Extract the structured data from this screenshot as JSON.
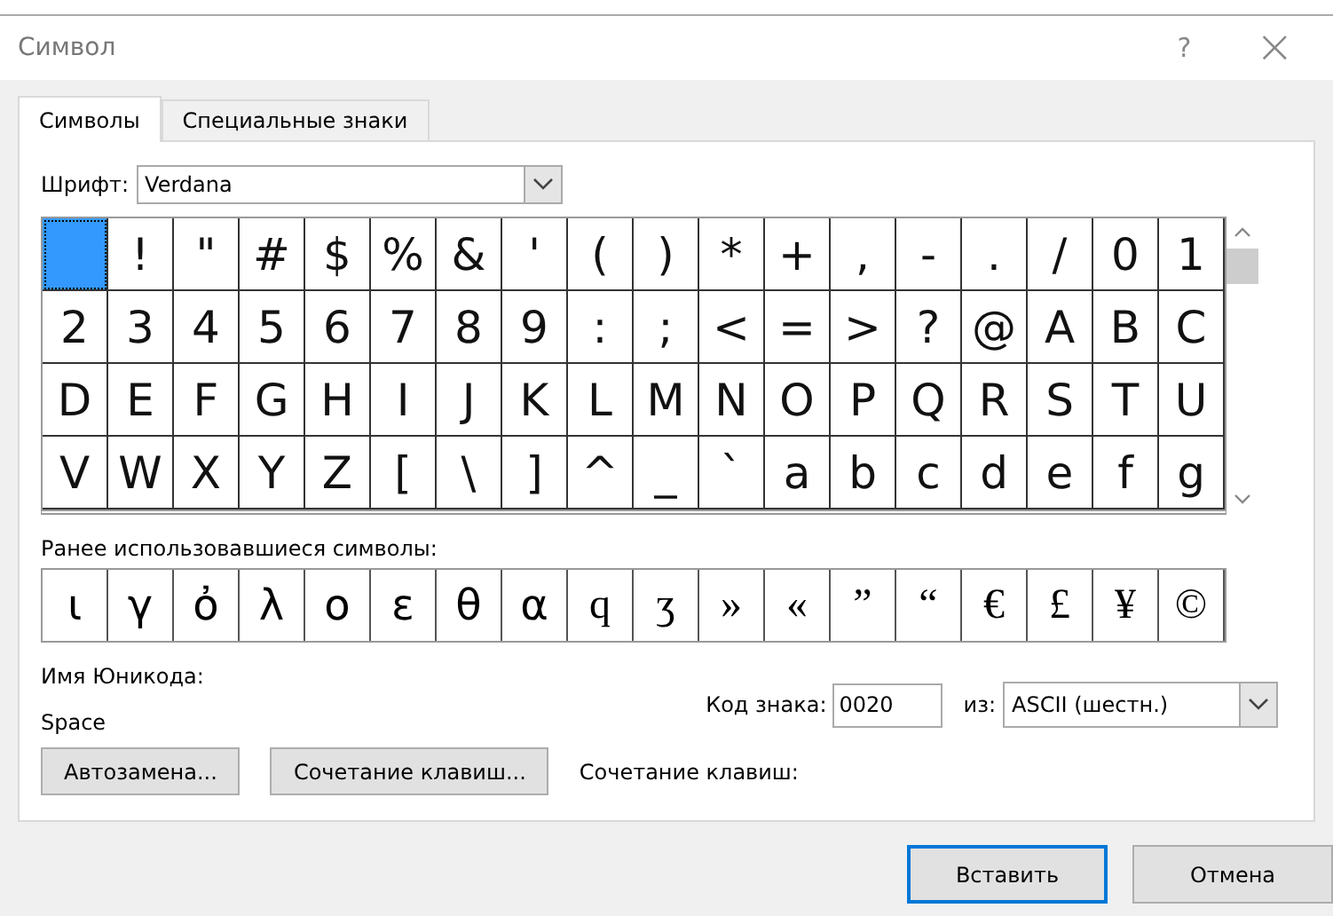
{
  "window": {
    "title": "Символ",
    "help": "?",
    "close": "×"
  },
  "tabs": [
    {
      "label": "Символы",
      "selected": true
    },
    {
      "label": "Специальные знаки",
      "selected": false
    }
  ],
  "font": {
    "label": "Шрифт:",
    "value": "Verdana"
  },
  "grid": [
    [
      {
        "selected": true
      },
      {
        "char": "!",
        "selected": false
      },
      {
        "char": "\"",
        "selected": false
      },
      {
        "char": "#",
        "selected": false
      },
      {
        "char": "$",
        "selected": false
      },
      {
        "char": "%",
        "selected": false
      },
      {
        "char": "&",
        "selected": false
      },
      {
        "char": "'",
        "selected": false
      },
      {
        "char": "(",
        "selected": false
      },
      {
        "char": ")",
        "selected": false
      },
      {
        "char": "*",
        "selected": false
      },
      {
        "char": "+",
        "selected": false
      },
      {
        "char": ",",
        "selected": false
      },
      {
        "char": "-",
        "selected": false
      },
      {
        "char": ".",
        "selected": false
      },
      {
        "char": "/",
        "selected": false
      },
      {
        "char": "0",
        "selected": false
      },
      {
        "char": "1",
        "selected": false
      }
    ],
    [
      {
        "char": "2",
        "selected": false
      },
      {
        "char": "3",
        "selected": false
      },
      {
        "char": "4",
        "selected": false
      },
      {
        "char": "5",
        "selected": false
      },
      {
        "char": "6",
        "selected": false
      },
      {
        "char": "7",
        "selected": false
      },
      {
        "char": "8",
        "selected": false
      },
      {
        "char": "9",
        "selected": false
      },
      {
        "char": ":",
        "selected": false
      },
      {
        "char": ";",
        "selected": false
      },
      {
        "char": "<",
        "selected": false
      },
      {
        "char": "=",
        "selected": false
      },
      {
        "char": ">",
        "selected": false
      },
      {
        "char": "?",
        "selected": false
      },
      {
        "char": "@",
        "selected": false
      },
      {
        "char": "A",
        "selected": false
      },
      {
        "char": "B",
        "selected": false
      },
      {
        "char": "C",
        "selected": false
      }
    ],
    [
      {
        "char": "D",
        "selected": false
      },
      {
        "char": "E",
        "selected": false
      },
      {
        "char": "F",
        "selected": false
      },
      {
        "char": "G",
        "selected": false
      },
      {
        "char": "H",
        "selected": false
      },
      {
        "char": "I",
        "selected": false
      },
      {
        "char": "J",
        "selected": false
      },
      {
        "char": "K",
        "selected": false
      },
      {
        "char": "L",
        "selected": false
      },
      {
        "char": "M",
        "selected": false
      },
      {
        "char": "N",
        "selected": false
      },
      {
        "char": "O",
        "selected": false
      },
      {
        "char": "P",
        "selected": false
      },
      {
        "char": "Q",
        "selected": false
      },
      {
        "char": "R",
        "selected": false
      },
      {
        "char": "S",
        "selected": false
      },
      {
        "char": "T",
        "selected": false
      },
      {
        "char": "U",
        "selected": false
      }
    ],
    [
      {
        "char": "V",
        "selected": false
      },
      {
        "char": "W",
        "selected": false
      },
      {
        "char": "X",
        "selected": false
      },
      {
        "char": "Y",
        "selected": false
      },
      {
        "char": "Z",
        "selected": false
      },
      {
        "char": "[",
        "selected": false
      },
      {
        "char": "\\",
        "selected": false
      },
      {
        "char": "]",
        "selected": false
      },
      {
        "char": "^",
        "selected": false
      },
      {
        "char": "_",
        "selected": false
      },
      {
        "char": "`",
        "selected": false
      },
      {
        "char": "a",
        "selected": false
      },
      {
        "char": "b",
        "selected": false
      },
      {
        "char": "c",
        "selected": false
      },
      {
        "char": "d",
        "selected": false
      },
      {
        "char": "e",
        "selected": false
      },
      {
        "char": "f",
        "selected": false
      },
      {
        "char": "g",
        "selected": false
      }
    ]
  ],
  "recent": {
    "label": "Ранее использовавшиеся символы:",
    "symbols": [
      {
        "char": "ι",
        "kind": "sans"
      },
      {
        "char": "γ",
        "kind": "sans"
      },
      {
        "char": "ὀ",
        "kind": "sans"
      },
      {
        "char": "λ",
        "kind": "sans"
      },
      {
        "char": "ο",
        "kind": "sans"
      },
      {
        "char": "ε",
        "kind": "sans"
      },
      {
        "char": "θ",
        "kind": "sans"
      },
      {
        "char": "α",
        "kind": "sans"
      },
      {
        "char": "q",
        "kind": "serif"
      },
      {
        "char": "ʒ",
        "kind": "serif"
      },
      {
        "char": "»",
        "kind": "serif"
      },
      {
        "char": "«",
        "kind": "serif"
      },
      {
        "char": "”",
        "kind": "serif"
      },
      {
        "char": "“",
        "kind": "serif"
      },
      {
        "char": "€",
        "kind": "serif"
      },
      {
        "char": "£",
        "kind": "serif"
      },
      {
        "char": "¥",
        "kind": "serif"
      },
      {
        "char": "©",
        "kind": "serif"
      }
    ]
  },
  "unicode_name": {
    "label": "Имя Юникода:",
    "value": "Space"
  },
  "code": {
    "label": "Код знака:",
    "value": "0020"
  },
  "from": {
    "label": "из:",
    "value": "ASCII (шестн.)"
  },
  "buttons": [
    {
      "label": "Автозамена..."
    },
    {
      "label": "Сочетание клавиш..."
    }
  ],
  "shortcut_label": "Сочетание клавиш:",
  "footer_buttons": [
    {
      "label": "Вставить",
      "default": true
    },
    {
      "label": "Отмена",
      "default": false
    }
  ]
}
